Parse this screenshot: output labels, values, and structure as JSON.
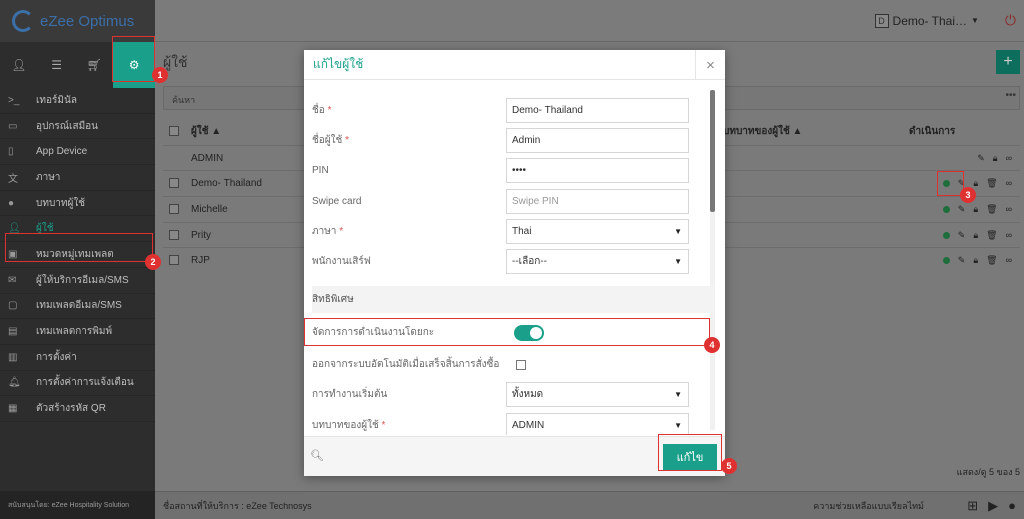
{
  "app": {
    "logo_text": "eZee Optimus"
  },
  "topbar": {
    "property_badge": "D",
    "property_name": "Demo- Thai…"
  },
  "sidebar": {
    "items": [
      {
        "label": "เทอร์มินัล",
        "icon": "terminal-icon"
      },
      {
        "label": "อุปกรณ์เสมือน",
        "icon": "tablet-icon"
      },
      {
        "label": "App Device",
        "icon": "phone-icon"
      },
      {
        "label": "ภาษา",
        "icon": "language-icon"
      },
      {
        "label": "บทบาทผู้ใช้",
        "icon": "user-role-icon"
      },
      {
        "label": "ผู้ใช้",
        "icon": "user-icon"
      },
      {
        "label": "หมวดหมู่เทมเพลต",
        "icon": "inbox-icon"
      },
      {
        "label": "ผู้ให้บริการอีเมล/SMS",
        "icon": "mail-icon"
      },
      {
        "label": "เทมเพลตอีเมล/SMS",
        "icon": "window-icon"
      },
      {
        "label": "เทมเพลตการพิมพ์",
        "icon": "print-template-icon"
      },
      {
        "label": "การตั้งค่า",
        "icon": "settings-list-icon"
      },
      {
        "label": "การตั้งค่าการแจ้งเตือน",
        "icon": "bell-icon"
      },
      {
        "label": "ตัวสร้างรหัส QR",
        "icon": "qr-icon"
      }
    ],
    "footer": "สนับสนุนโดย: eZee Hospitality Solution"
  },
  "page": {
    "title": "ผู้ใช้",
    "search_placeholder": "ค้นหา",
    "col_user": "ผู้ใช้ ▲",
    "col_role": "บทบาทของผู้ใช้ ▲",
    "col_actions": "ดำเนินการ",
    "rows": [
      "ADMIN",
      "Demo- Thailand",
      "Michelle",
      "Prity",
      "RJP"
    ],
    "paging": "แสดง/ดู 5 ของ 5",
    "footer_text": "ชื่อสถานที่ให้บริการ : eZee Technosys",
    "support_text": "ความช่วยเหลือแบบเรียลไทม์"
  },
  "modal": {
    "title": "แก้ไขผู้ใช้",
    "close": "×",
    "fields": {
      "name_label": "ชื่อ",
      "name_value": "Demo- Thailand",
      "username_label": "ชื่อผู้ใช้",
      "username_value": "Admin",
      "pin_label": "PIN",
      "pin_value": "••••",
      "swipe_label": "Swipe card",
      "swipe_placeholder": "Swipe PIN",
      "language_label": "ภาษา",
      "language_value": "Thai",
      "waiter_label": "พนักงานเสิร์ฟ",
      "waiter_value": "--เลือก--"
    },
    "section_title": "สิทธิพิเศษ",
    "toggle_label": "จัดการการดำเนินงานโดยกะ",
    "toggle_on": true,
    "auto_logout_label": "ออกจากระบบอัตโนมัติเมื่อเสร็จสิ้นการสั่งซื้อ",
    "start_operation_label": "การทำงานเริ่มต้น",
    "start_operation_value": "ทั้งหมด",
    "user_role_label": "บทบาทของผู้ใช้",
    "user_role_value": "ADMIN",
    "save_label": "แก้ไข",
    "required_mark": "*"
  },
  "annotations": [
    "1",
    "2",
    "3",
    "4",
    "5"
  ],
  "colors": {
    "accent": "#1aa08a",
    "annotation": "#e03131"
  }
}
